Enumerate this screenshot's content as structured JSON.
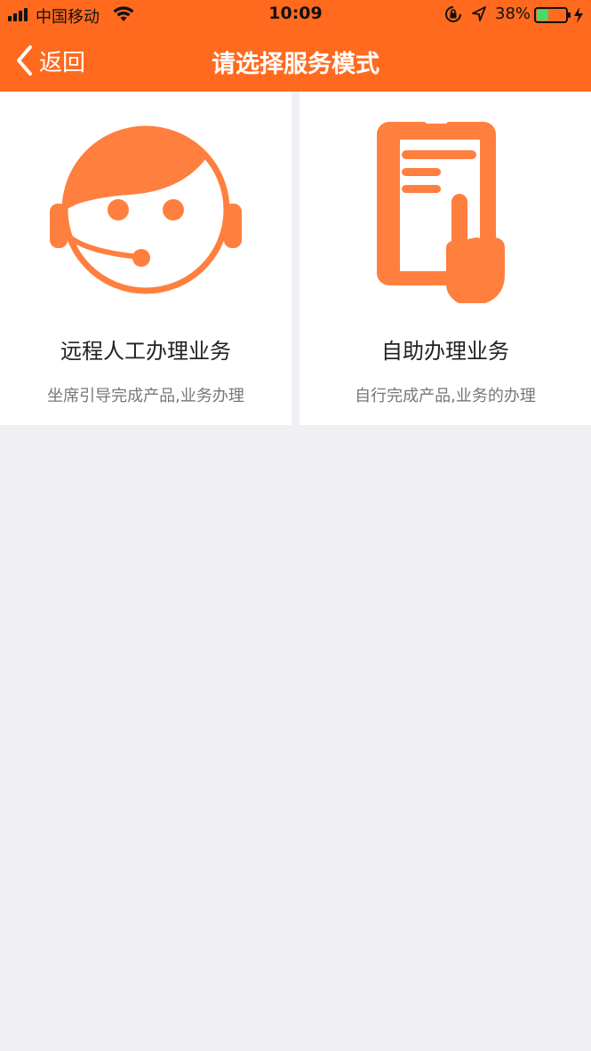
{
  "status_bar": {
    "carrier": "中国移动",
    "time": "10:09",
    "battery_percent": "38%",
    "battery_level": 0.38,
    "battery_color": "#4CD964"
  },
  "nav": {
    "back_label": "返回",
    "title": "请选择服务模式",
    "bar_color": "#FF6A1F"
  },
  "options": [
    {
      "title": "远程人工办理业务",
      "description": "坐席引导完成产品,业务办理",
      "icon": "customer-service-headset-icon"
    },
    {
      "title": "自助办理业务",
      "description": "自行完成产品,业务的办理",
      "icon": "self-service-phone-tap-icon"
    }
  ],
  "colors": {
    "accent": "#FF6A1F",
    "icon": "#FF7F3F",
    "background": "#EFEFF4"
  }
}
